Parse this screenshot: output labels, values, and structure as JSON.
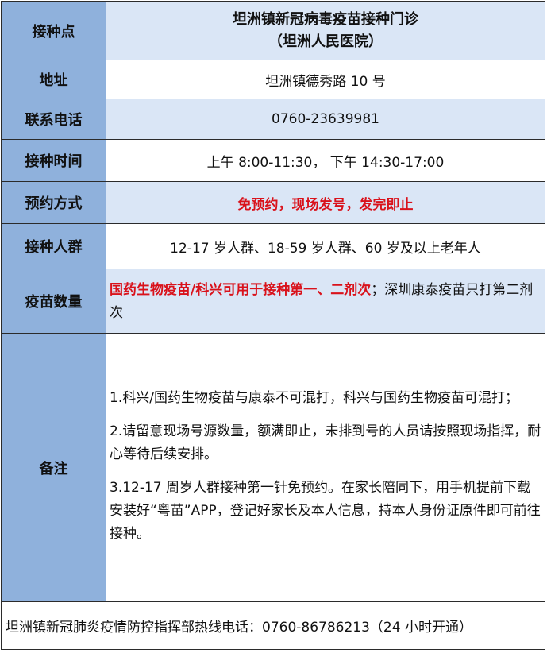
{
  "rows": {
    "site": {
      "label": "接种点",
      "line1": "坦洲镇新冠病毒疫苗接种门诊",
      "line2": "（坦洲人民医院）"
    },
    "address": {
      "label": "地址",
      "value": "坦洲镇德秀路 10 号"
    },
    "phone": {
      "label": "联系电话",
      "value": "0760-23639981"
    },
    "time": {
      "label": "接种时间",
      "value": "上午 8:00-11:30，  下午 14:30-17:00"
    },
    "booking": {
      "label": "预约方式",
      "value": "免预约，现场发号，发完即止"
    },
    "group": {
      "label": "接种人群",
      "value": "12-17 岁人群、18-59 岁人群、60 岁及以上老年人"
    },
    "quantity": {
      "label": "疫苗数量",
      "highlight": "国药生物疫苗/科兴可用于接种第一、二剂次",
      "rest": "；深圳康泰疫苗只打第二剂次"
    },
    "notes": {
      "label": "备注",
      "items": [
        "1.科兴/国药生物疫苗与康泰不可混打，科兴与国药生物疫苗可混打；",
        "2.请留意现场号源数量，额满即止，未排到号的人员请按照现场指挥，耐心等待后续安排。",
        "3.12-17 周岁人群接种第一针免预约。在家长陪同下，用手机提前下载安装好“粤苗”APP，登记好家长及本人信息，持本人身份证原件即可前往接种。"
      ]
    }
  },
  "footer": "坦洲镇新冠肺炎疫情防控指挥部热线电话：0760-86786213（24 小时开通）",
  "colors": {
    "label_bg": "#8fb1dc",
    "alt_row_bg": "#dae6f6",
    "highlight": "#d9121b",
    "border": "#2b2b2b"
  }
}
